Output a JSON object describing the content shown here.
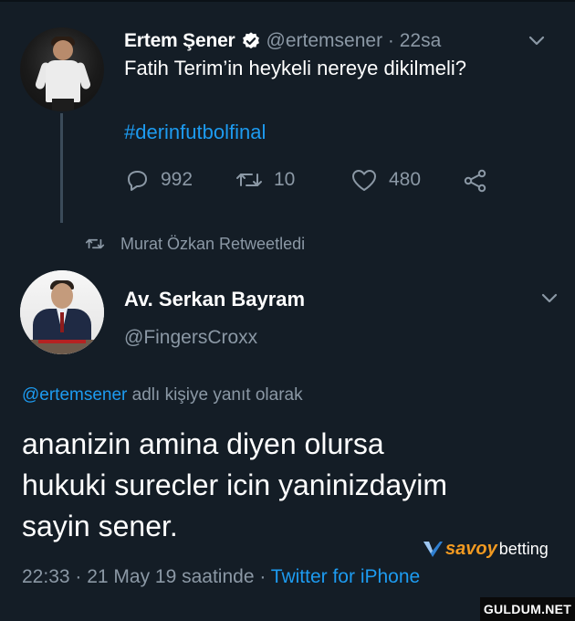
{
  "tweet1": {
    "author_name": "Ertem Şener",
    "author_handle": "@ertemsener · 22sa",
    "text": "Fatih Terim’in heykeli nereye dikilmeli?",
    "hashtag": "#derinfutbolfinal",
    "actions": {
      "replies": "992",
      "retweets": "10",
      "likes": "480"
    }
  },
  "retweet_notice": "Murat Özkan Retweetledi",
  "tweet2": {
    "author_name": "Av. Serkan Bayram",
    "author_handle": "@FingersCroxx",
    "reply_mention": "@ertemsener",
    "reply_suffix": " adlı kişiye yanıt olarak",
    "body_lines": [
      "ananizin amina diyen olursa",
      "hukuki surecler icin yaninizdayim",
      "sayin sener."
    ],
    "timestamp": "22:33 · 21 May 19 saatinde · ",
    "client": "Twitter for iPhone"
  },
  "watermarks": {
    "savoy_brand": "savoy",
    "savoy_suffix": "betting",
    "site": "GULDUM.NET"
  },
  "colors": {
    "background": "#141d26",
    "link": "#1d9bf0",
    "muted": "#8b98a5",
    "text": "#ffffff",
    "savoy_accent": "#f29a21"
  },
  "icons": {
    "verified": "verified-badge-icon",
    "chevron": "chevron-down-icon",
    "reply": "reply-bubble-icon",
    "retweet": "retweet-arrows-icon",
    "like": "heart-icon",
    "share": "share-icon"
  }
}
